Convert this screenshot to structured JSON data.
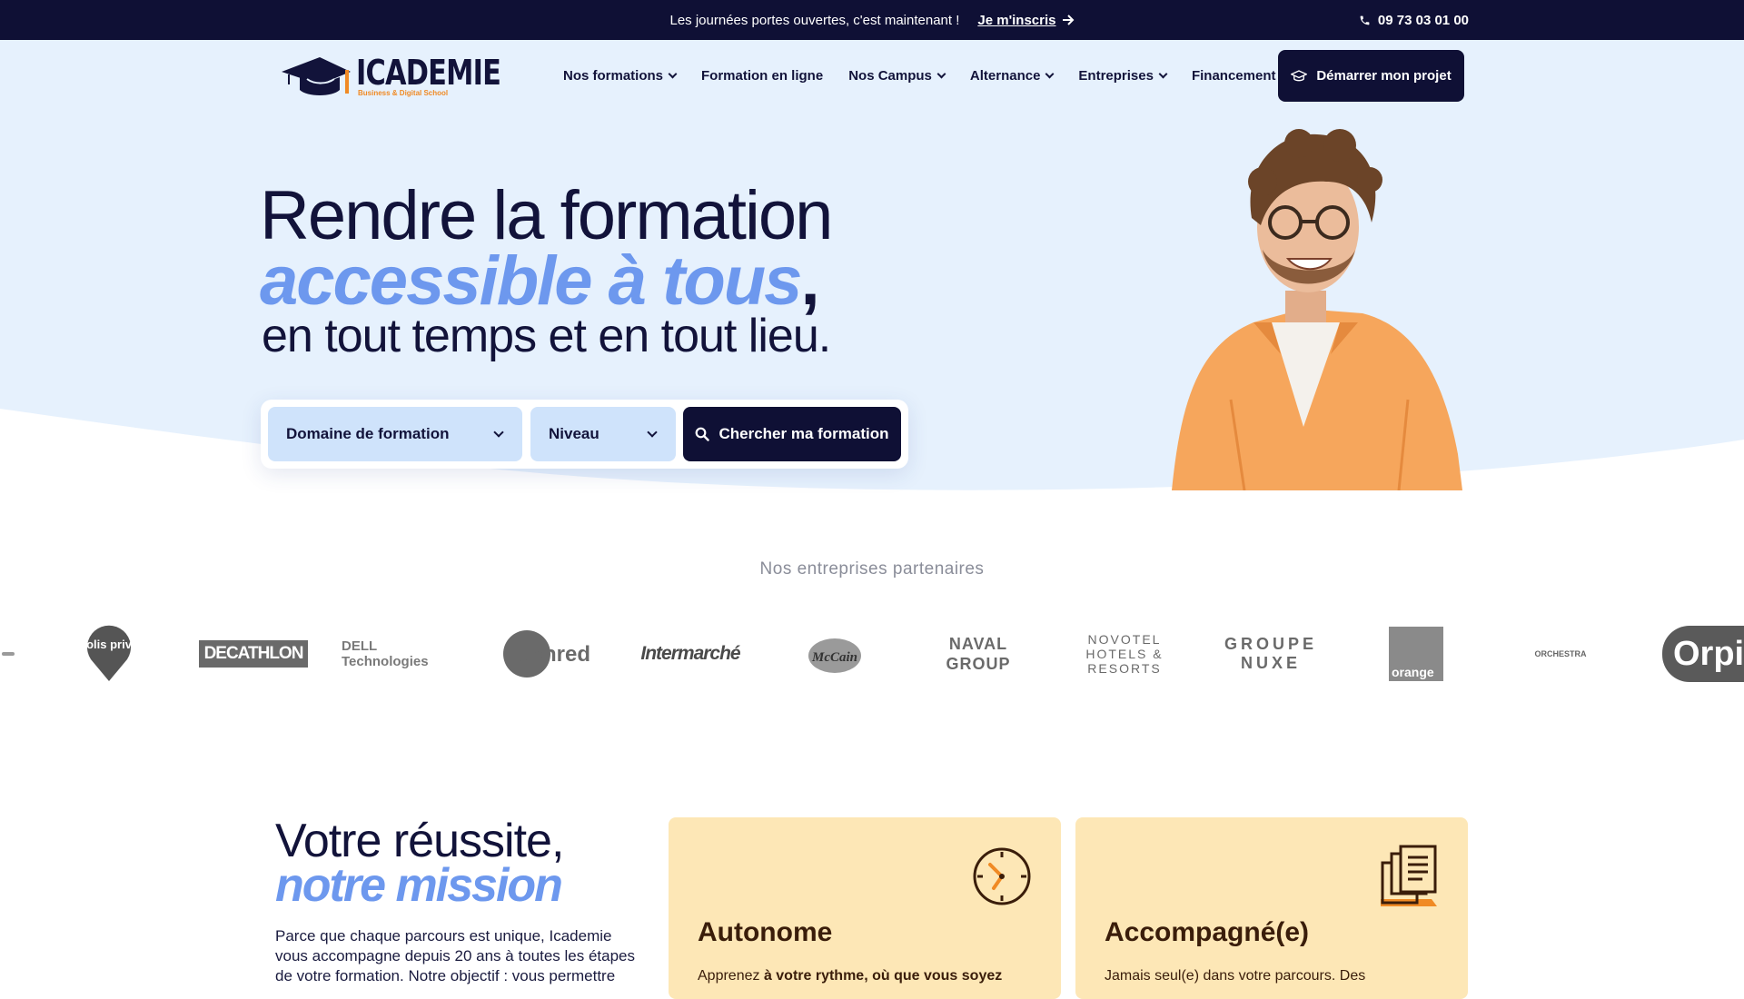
{
  "topbar": {
    "promo_text": "Les journées portes ouvertes, c'est maintenant !",
    "promo_cta": "Je m'inscris",
    "phone": "09 73 03 01 00"
  },
  "brand": {
    "name": "ICADEMIE",
    "tagline": "Business & Digital School"
  },
  "nav": {
    "items": [
      {
        "label": "Nos formations",
        "dropdown": true
      },
      {
        "label": "Formation en ligne",
        "dropdown": false
      },
      {
        "label": "Nos Campus",
        "dropdown": true
      },
      {
        "label": "Alternance",
        "dropdown": true
      },
      {
        "label": "Entreprises",
        "dropdown": true
      },
      {
        "label": "Financement",
        "dropdown": true
      }
    ],
    "cta": "Démarrer mon projet"
  },
  "hero": {
    "line1": "Rendre la formation",
    "line2": "accessible à tous",
    "line2_suffix": ",",
    "line3": "en tout temps et en tout lieu."
  },
  "search": {
    "domain_label": "Domaine de formation",
    "level_label": "Niveau",
    "button_label": "Chercher ma formation"
  },
  "partners": {
    "title": "Nos entreprises partenaires",
    "logos": [
      "colis privé",
      "DECATHLON",
      "DELL Technologies",
      "Edenred",
      "Intermarché",
      "McCain",
      "NAVAL GROUP",
      "NOVOTEL HOTELS & RESORTS",
      "GROUPE NUXE",
      "orange",
      "ORCHESTRA",
      "Orpi"
    ]
  },
  "mission": {
    "title_line1": "Votre réussite,",
    "title_line2": "notre mission",
    "text": "Parce que chaque parcours est unique, Icademie vous accompagne depuis 20 ans à toutes les étapes de votre formation. Notre objectif : vous permettre"
  },
  "cards": [
    {
      "title": "Autonome",
      "desc_prefix": "Apprenez ",
      "desc_bold": "à votre rythme, où que vous soyez",
      "icon": "clock-icon"
    },
    {
      "title": "Accompagné(e)",
      "desc_prefix": "Jamais seul(e) dans votre parcours. Des",
      "desc_bold": "",
      "icon": "documents-icon"
    }
  ],
  "colors": {
    "navy": "#0f1035",
    "accent_blue": "#6d98ee",
    "hero_bg": "#e6f1fd",
    "select_bg": "#cfe3fb",
    "card_bg": "#fde7b6",
    "orange": "#f08a24"
  }
}
